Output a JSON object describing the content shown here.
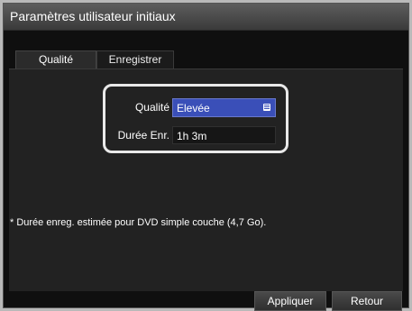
{
  "window": {
    "title": "Paramètres utilisateur initiaux"
  },
  "tabs": [
    {
      "label": "Qualité",
      "active": true
    },
    {
      "label": "Enregistrer",
      "active": false
    }
  ],
  "form": {
    "quality": {
      "label": "Qualité",
      "value": "Elevée"
    },
    "duration": {
      "label": "Durée Enr.",
      "value": "1h 3m"
    }
  },
  "note": "* Durée enreg. estimée pour DVD simple couche (4,7 Go).",
  "buttons": {
    "apply": "Appliquer",
    "back": "Retour"
  },
  "colors": {
    "select_bg": "#3a4fb8",
    "window_bg": "#0f0f0f",
    "highlight_frame": "#e9e9e9"
  }
}
